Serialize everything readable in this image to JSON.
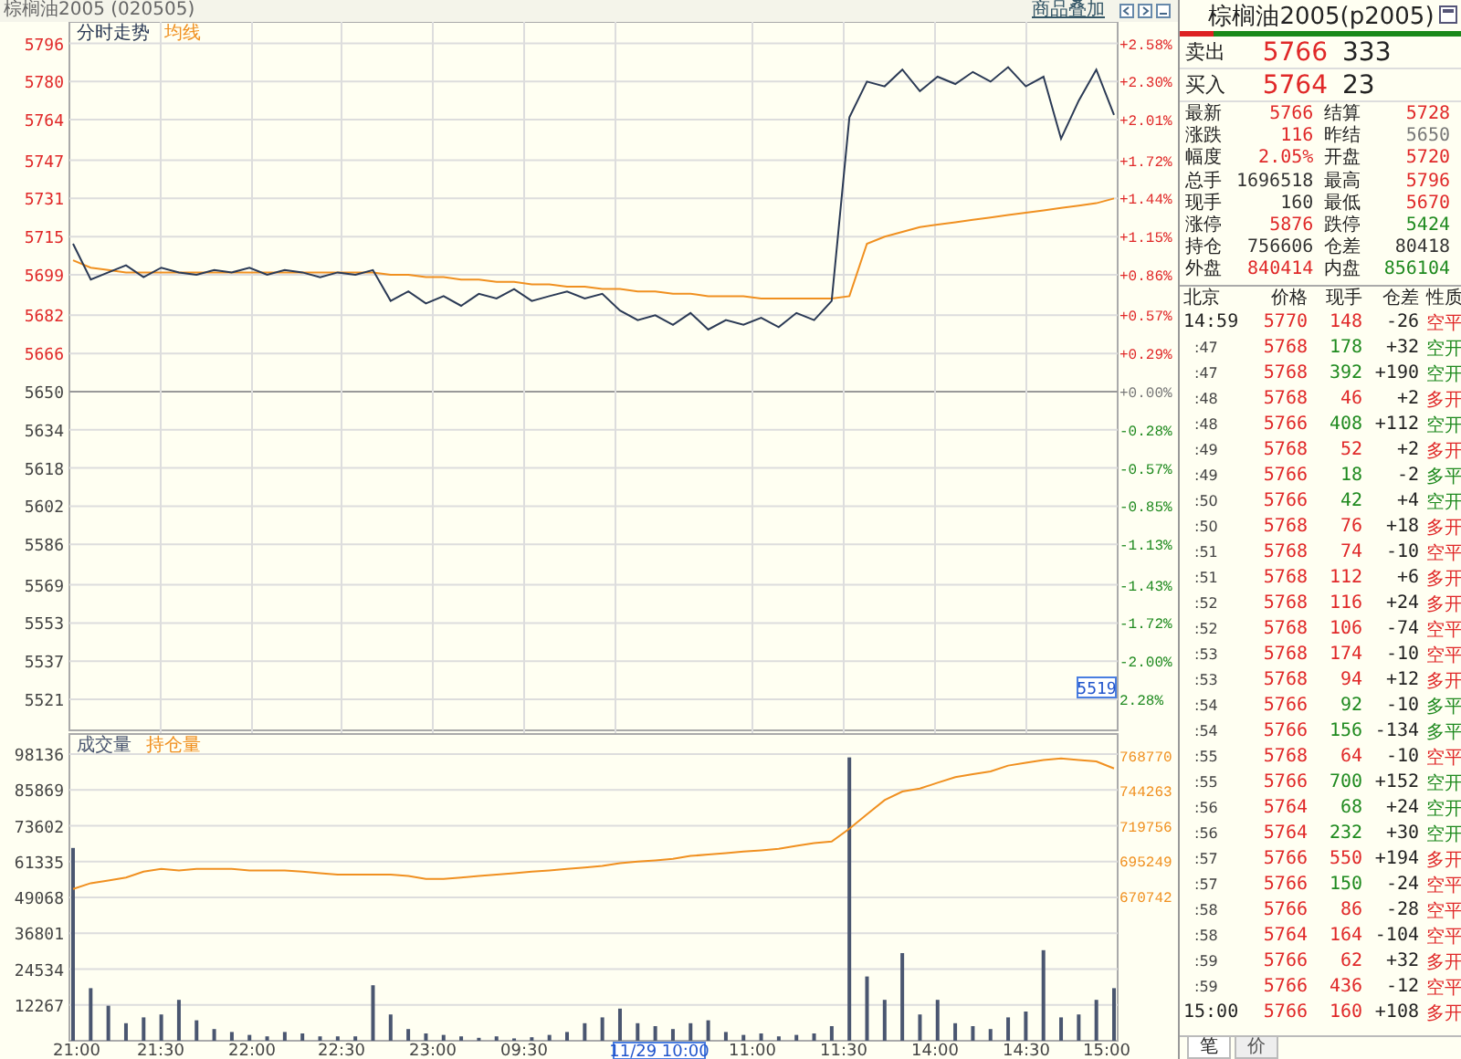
{
  "instrument": "棕榈油2005 (020505)",
  "overlay_link": "商品叠加",
  "price_chart": {
    "chart_data": {
      "type": "line",
      "ylim": [
        5508,
        5805
      ],
      "yticks": [
        5796,
        5780,
        5764,
        5747,
        5731,
        5715,
        5699,
        5682,
        5666,
        5650,
        5634,
        5618,
        5602,
        5586,
        5569,
        5553,
        5537,
        5521
      ],
      "series": [
        {
          "name": "分时走势",
          "color": "#2b3a55",
          "values": [
            5712,
            5697,
            5700,
            5703,
            5698,
            5702,
            5700,
            5699,
            5701,
            5700,
            5702,
            5699,
            5701,
            5700,
            5698,
            5700,
            5699,
            5701,
            5688,
            5692,
            5687,
            5690,
            5686,
            5691,
            5689,
            5693,
            5688,
            5690,
            5692,
            5689,
            5691,
            5684,
            5680,
            5682,
            5678,
            5683,
            5676,
            5680,
            5678,
            5681,
            5677,
            5683,
            5680,
            5688,
            5765,
            5780,
            5778,
            5785,
            5776,
            5782,
            5779,
            5784,
            5780,
            5786,
            5778,
            5782,
            5756,
            5772,
            5785,
            5766
          ]
        },
        {
          "name": "均线",
          "color": "#f09020",
          "values": [
            5705,
            5702,
            5701,
            5700,
            5700,
            5700,
            5700,
            5700,
            5700,
            5700,
            5700,
            5700,
            5700,
            5700,
            5700,
            5700,
            5700,
            5700,
            5699,
            5699,
            5698,
            5698,
            5697,
            5697,
            5696,
            5696,
            5695,
            5695,
            5694,
            5694,
            5693,
            5693,
            5692,
            5692,
            5691,
            5691,
            5690,
            5690,
            5690,
            5689,
            5689,
            5689,
            5689,
            5689,
            5690,
            5712,
            5715,
            5717,
            5719,
            5720,
            5721,
            5722,
            5723,
            5724,
            5725,
            5726,
            5727,
            5728,
            5729,
            5731
          ]
        }
      ]
    },
    "percent_axis": [
      {
        "label": "+2.58%",
        "kind": "up"
      },
      {
        "label": "+2.30%",
        "kind": "up"
      },
      {
        "label": "+2.01%",
        "kind": "up"
      },
      {
        "label": "+1.72%",
        "kind": "up"
      },
      {
        "label": "+1.44%",
        "kind": "up"
      },
      {
        "label": "+1.15%",
        "kind": "up"
      },
      {
        "label": "+0.86%",
        "kind": "up"
      },
      {
        "label": "+0.57%",
        "kind": "up"
      },
      {
        "label": "+0.29%",
        "kind": "up"
      },
      {
        "label": "+0.00%",
        "kind": "flat"
      },
      {
        "label": "-0.28%",
        "kind": "down"
      },
      {
        "label": "-0.57%",
        "kind": "down"
      },
      {
        "label": "-0.85%",
        "kind": "down"
      },
      {
        "label": "-1.13%",
        "kind": "down"
      },
      {
        "label": "-1.43%",
        "kind": "down"
      },
      {
        "label": "-1.72%",
        "kind": "down"
      },
      {
        "label": "-2.00%",
        "kind": "down"
      },
      {
        "label": "2.28%",
        "kind": "down"
      }
    ],
    "cursor_price": "5519"
  },
  "volume_chart": {
    "chart_data": {
      "type": "bar",
      "ylim": [
        0,
        98136
      ],
      "yticks": [
        98136,
        85869,
        73602,
        61335,
        49068,
        36801,
        24534,
        12267
      ],
      "categories": [
        null,
        null,
        null,
        null,
        null,
        null,
        null,
        null,
        null,
        null,
        null,
        null,
        null,
        null,
        null,
        null,
        null,
        null,
        null,
        null,
        null,
        null,
        null,
        null,
        null,
        null,
        null,
        null,
        null,
        null,
        null,
        null,
        null,
        null,
        null,
        null,
        null,
        null,
        null,
        null,
        null,
        null,
        null,
        null,
        null,
        null,
        null,
        null,
        null,
        null,
        null,
        null,
        null,
        null,
        null,
        null,
        null,
        null,
        null,
        null
      ],
      "series": [
        {
          "name": "成交量",
          "color": "#4a5670",
          "values": [
            66000,
            18000,
            12000,
            6000,
            8000,
            9000,
            14000,
            7000,
            4000,
            3000,
            2000,
            1500,
            3000,
            2500,
            1500,
            1500,
            1500,
            19000,
            9000,
            4000,
            2500,
            2000,
            1500,
            1000,
            1500,
            800,
            1200,
            2000,
            3000,
            6000,
            8000,
            11000,
            6000,
            5000,
            4000,
            6000,
            7000,
            3000,
            2000,
            2500,
            1500,
            2000,
            2500,
            5000,
            97000,
            22000,
            14000,
            30000,
            9000,
            14000,
            6000,
            5000,
            4000,
            8000,
            10000,
            31000,
            8000,
            9000,
            14000,
            18000
          ]
        }
      ]
    },
    "time_axis": [
      "21:00",
      "21:30",
      "22:00",
      "22:30",
      "23:00",
      "09:30",
      "11:00",
      "11:30",
      "14:00",
      "14:30",
      "15:00"
    ],
    "cursor_time": "11/29 10:00"
  },
  "open_interest_chart": {
    "chart_data": {
      "type": "line",
      "ylim": [
        570167,
        784047
      ],
      "yticks": [
        768770,
        744263,
        719756,
        695249,
        670742
      ],
      "series": [
        {
          "name": "持仓量",
          "color": "#f09020",
          "values": [
            676000,
            680000,
            682000,
            684000,
            688000,
            690000,
            689000,
            690000,
            690000,
            690000,
            689000,
            689000,
            689000,
            688000,
            687000,
            686000,
            686000,
            686000,
            686000,
            685000,
            683000,
            683000,
            684000,
            685000,
            686000,
            687000,
            688000,
            689000,
            690000,
            691000,
            692000,
            694000,
            695000,
            696000,
            697000,
            699000,
            700000,
            701000,
            702000,
            703000,
            704000,
            706000,
            708000,
            709000,
            718000,
            728000,
            738000,
            744000,
            746000,
            750000,
            754000,
            756000,
            758000,
            762000,
            764000,
            766000,
            767000,
            766000,
            765000,
            760000
          ]
        }
      ]
    }
  },
  "quote": {
    "title": "棕榈油2005(p2005)",
    "book": [
      {
        "label": "卖出",
        "price": "5766",
        "volume": "333"
      },
      {
        "label": "买入",
        "price": "5764",
        "volume": "23"
      }
    ],
    "stats": [
      {
        "label": "最新",
        "value": "5766",
        "kind": "up"
      },
      {
        "label": "结算",
        "value": "5728",
        "kind": "up"
      },
      {
        "label": "涨跌",
        "value": "116",
        "kind": "up"
      },
      {
        "label": "昨结",
        "value": "5650",
        "kind": "flat"
      },
      {
        "label": "幅度",
        "value": "2.05%",
        "kind": "up"
      },
      {
        "label": "开盘",
        "value": "5720",
        "kind": "up"
      },
      {
        "label": "总手",
        "value": "1696518",
        "kind": "plain"
      },
      {
        "label": "最高",
        "value": "5796",
        "kind": "up"
      },
      {
        "label": "现手",
        "value": "160",
        "kind": "plain"
      },
      {
        "label": "最低",
        "value": "5670",
        "kind": "up"
      },
      {
        "label": "涨停",
        "value": "5876",
        "kind": "up"
      },
      {
        "label": "跌停",
        "value": "5424",
        "kind": "down"
      },
      {
        "label": "持仓",
        "value": "756606",
        "kind": "plain"
      },
      {
        "label": "仓差",
        "value": "80418",
        "kind": "plain"
      },
      {
        "label": "外盘",
        "value": "840414",
        "kind": "up"
      },
      {
        "label": "内盘",
        "value": "856104",
        "kind": "down"
      }
    ],
    "columns": [
      "北京",
      "价格",
      "现手",
      "仓差",
      "性质"
    ],
    "trades": [
      {
        "time": "14:59",
        "kind": "full",
        "price": "5770",
        "volume": "148",
        "volume_up": true,
        "oi_change": "-26",
        "nature": "空平",
        "nature_up": true
      },
      {
        "time": ":47",
        "kind": "minute",
        "price": "5768",
        "volume": "178",
        "volume_up": false,
        "oi_change": "+32",
        "nature": "空开",
        "nature_up": false
      },
      {
        "time": ":47",
        "kind": "minute",
        "price": "5768",
        "volume": "392",
        "volume_up": false,
        "oi_change": "+190",
        "nature": "空开",
        "nature_up": false
      },
      {
        "time": ":48",
        "kind": "minute",
        "price": "5768",
        "volume": "46",
        "volume_up": true,
        "oi_change": "+2",
        "nature": "多开",
        "nature_up": true
      },
      {
        "time": ":48",
        "kind": "minute",
        "price": "5766",
        "volume": "408",
        "volume_up": false,
        "oi_change": "+112",
        "nature": "空开",
        "nature_up": false
      },
      {
        "time": ":49",
        "kind": "minute",
        "price": "5768",
        "volume": "52",
        "volume_up": true,
        "oi_change": "+2",
        "nature": "多开",
        "nature_up": true
      },
      {
        "time": ":49",
        "kind": "minute",
        "price": "5766",
        "volume": "18",
        "volume_up": false,
        "oi_change": "-2",
        "nature": "多平",
        "nature_up": false
      },
      {
        "time": ":50",
        "kind": "minute",
        "price": "5766",
        "volume": "42",
        "volume_up": false,
        "oi_change": "+4",
        "nature": "空开",
        "nature_up": false
      },
      {
        "time": ":50",
        "kind": "minute",
        "price": "5768",
        "volume": "76",
        "volume_up": true,
        "oi_change": "+18",
        "nature": "多开",
        "nature_up": true
      },
      {
        "time": ":51",
        "kind": "minute",
        "price": "5768",
        "volume": "74",
        "volume_up": true,
        "oi_change": "-10",
        "nature": "空平",
        "nature_up": true
      },
      {
        "time": ":51",
        "kind": "minute",
        "price": "5768",
        "volume": "112",
        "volume_up": true,
        "oi_change": "+6",
        "nature": "多开",
        "nature_up": true
      },
      {
        "time": ":52",
        "kind": "minute",
        "price": "5768",
        "volume": "116",
        "volume_up": true,
        "oi_change": "+24",
        "nature": "多开",
        "nature_up": true
      },
      {
        "time": ":52",
        "kind": "minute",
        "price": "5768",
        "volume": "106",
        "volume_up": true,
        "oi_change": "-74",
        "nature": "空平",
        "nature_up": true
      },
      {
        "time": ":53",
        "kind": "minute",
        "price": "5768",
        "volume": "174",
        "volume_up": true,
        "oi_change": "-10",
        "nature": "空平",
        "nature_up": true
      },
      {
        "time": ":53",
        "kind": "minute",
        "price": "5768",
        "volume": "94",
        "volume_up": true,
        "oi_change": "+12",
        "nature": "多开",
        "nature_up": true
      },
      {
        "time": ":54",
        "kind": "minute",
        "price": "5766",
        "volume": "92",
        "volume_up": false,
        "oi_change": "-10",
        "nature": "多平",
        "nature_up": false
      },
      {
        "time": ":54",
        "kind": "minute",
        "price": "5766",
        "volume": "156",
        "volume_up": false,
        "oi_change": "-134",
        "nature": "多平",
        "nature_up": false
      },
      {
        "time": ":55",
        "kind": "minute",
        "price": "5768",
        "volume": "64",
        "volume_up": true,
        "oi_change": "-10",
        "nature": "空平",
        "nature_up": true
      },
      {
        "time": ":55",
        "kind": "minute",
        "price": "5766",
        "volume": "700",
        "volume_up": false,
        "oi_change": "+152",
        "nature": "空开",
        "nature_up": false
      },
      {
        "time": ":56",
        "kind": "minute",
        "price": "5764",
        "volume": "68",
        "volume_up": false,
        "oi_change": "+24",
        "nature": "空开",
        "nature_up": false
      },
      {
        "time": ":56",
        "kind": "minute",
        "price": "5764",
        "volume": "232",
        "volume_up": false,
        "oi_change": "+30",
        "nature": "空开",
        "nature_up": false
      },
      {
        "time": ":57",
        "kind": "minute",
        "price": "5766",
        "volume": "550",
        "volume_up": true,
        "oi_change": "+194",
        "nature": "多开",
        "nature_up": true
      },
      {
        "time": ":57",
        "kind": "minute",
        "price": "5766",
        "volume": "150",
        "volume_up": false,
        "oi_change": "-24",
        "nature": "空平",
        "nature_up": true
      },
      {
        "time": ":58",
        "kind": "minute",
        "price": "5766",
        "volume": "86",
        "volume_up": true,
        "oi_change": "-28",
        "nature": "空平",
        "nature_up": true
      },
      {
        "time": ":58",
        "kind": "minute",
        "price": "5764",
        "volume": "164",
        "volume_up": true,
        "oi_change": "-104",
        "nature": "空平",
        "nature_up": true
      },
      {
        "time": ":59",
        "kind": "minute",
        "price": "5766",
        "volume": "62",
        "volume_up": true,
        "oi_change": "+32",
        "nature": "多开",
        "nature_up": true
      },
      {
        "time": ":59",
        "kind": "minute",
        "price": "5766",
        "volume": "436",
        "volume_up": true,
        "oi_change": "-12",
        "nature": "空平",
        "nature_up": true
      },
      {
        "time": "15:00",
        "kind": "full",
        "price": "5766",
        "volume": "160",
        "volume_up": true,
        "oi_change": "+108",
        "nature": "多开",
        "nature_up": true
      }
    ],
    "tabs": [
      {
        "label": "笔",
        "selected": true
      },
      {
        "label": "价",
        "selected": false
      }
    ]
  }
}
